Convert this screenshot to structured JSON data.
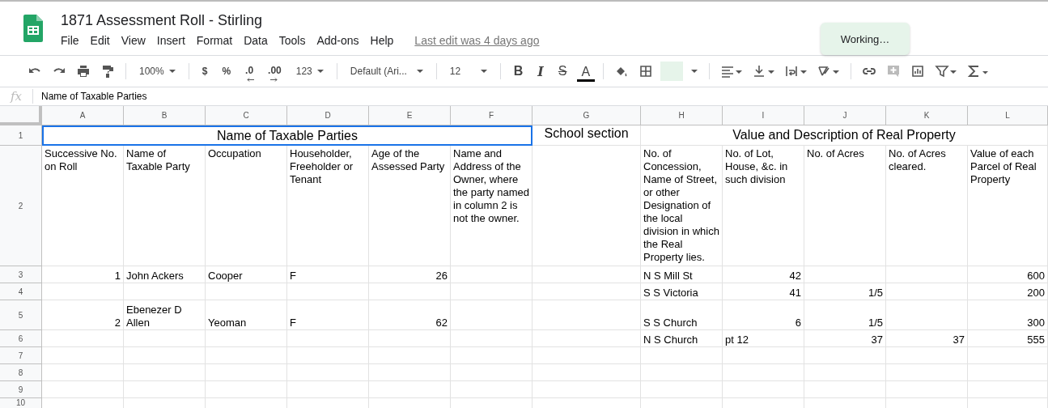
{
  "document": {
    "title": "1871 Assessment Roll - Stirling",
    "last_edit": "Last edit was 4 days ago"
  },
  "menu": [
    "File",
    "Edit",
    "View",
    "Insert",
    "Format",
    "Data",
    "Tools",
    "Add-ons",
    "Help"
  ],
  "toast": "Working…",
  "toolbar": {
    "zoom": "100%",
    "currency": "$",
    "percent": "%",
    "decrease_decimal": ".0",
    "increase_decimal": ".00",
    "more_formats": "123",
    "font": "Default (Ari...",
    "font_size": "12",
    "bold": "B",
    "italic": "I",
    "strikethrough": "S",
    "text_color": "A"
  },
  "formula_bar": {
    "label": "fx",
    "value": "Name of Taxable Parties"
  },
  "columns": [
    "A",
    "B",
    "C",
    "D",
    "E",
    "F",
    "G",
    "H",
    "I",
    "J",
    "K",
    "L"
  ],
  "rows": [
    {
      "number": "1",
      "kind": "title",
      "cells": [
        {
          "kind": "title",
          "text": "Name of Taxable Parties",
          "selected": true
        },
        {
          "kind": "merged"
        },
        {
          "kind": "merged"
        },
        {
          "kind": "merged"
        },
        {
          "kind": "merged"
        },
        {
          "kind": "merged"
        },
        {
          "kind": "text",
          "text": "School section",
          "selected": false
        },
        {
          "kind": "title",
          "text": "Value and Description of Real Property",
          "selected": false
        },
        {
          "kind": "merged"
        },
        {
          "kind": "merged"
        },
        {
          "kind": "merged"
        },
        {
          "kind": "merged"
        }
      ]
    },
    {
      "number": "2",
      "kind": "header",
      "cells": [
        {
          "kind": "text",
          "text": "Successive No. on Roll",
          "selected": false
        },
        {
          "kind": "text",
          "text": "Name of Taxable Party",
          "selected": false
        },
        {
          "kind": "text",
          "text": "Occupation",
          "selected": false
        },
        {
          "kind": "text",
          "text": "Householder, Freeholder or Tenant",
          "selected": false
        },
        {
          "kind": "text",
          "text": "Age of the Assessed Party",
          "selected": false
        },
        {
          "kind": "text",
          "text": "Name and Address of the Owner, where the party named in column 2 is not the owner.",
          "selected": false
        },
        {
          "kind": "empty"
        },
        {
          "kind": "text",
          "text": "No. of Concession, Name of Street, or other Designation of the local division in which the Real Property lies.",
          "selected": false
        },
        {
          "kind": "text",
          "text": "No. of Lot, House, &c. in such division",
          "selected": false
        },
        {
          "kind": "text",
          "text": "No. of Acres",
          "selected": false
        },
        {
          "kind": "text",
          "text": "No. of Acres cleared.",
          "selected": false
        },
        {
          "kind": "text",
          "text": "Value of each Parcel of Real Property",
          "selected": false
        }
      ]
    },
    {
      "number": "3",
      "kind": "data",
      "cells": [
        {
          "kind": "number",
          "text": "1",
          "selected": false
        },
        {
          "kind": "text",
          "text": "John Ackers",
          "selected": false
        },
        {
          "kind": "text",
          "text": "Cooper",
          "selected": false
        },
        {
          "kind": "text",
          "text": "F",
          "selected": false
        },
        {
          "kind": "number",
          "text": "26",
          "selected": false
        },
        {
          "kind": "empty"
        },
        {
          "kind": "empty"
        },
        {
          "kind": "text",
          "text": "N S Mill St",
          "selected": false
        },
        {
          "kind": "number",
          "text": "42",
          "selected": false
        },
        {
          "kind": "empty"
        },
        {
          "kind": "empty"
        },
        {
          "kind": "number",
          "text": "600",
          "selected": false
        }
      ]
    },
    {
      "number": "4",
      "kind": "data",
      "cells": [
        {
          "kind": "empty"
        },
        {
          "kind": "empty"
        },
        {
          "kind": "empty"
        },
        {
          "kind": "empty"
        },
        {
          "kind": "empty"
        },
        {
          "kind": "empty"
        },
        {
          "kind": "empty"
        },
        {
          "kind": "text",
          "text": "S S Victoria",
          "selected": false
        },
        {
          "kind": "number",
          "text": "41",
          "selected": false
        },
        {
          "kind": "number",
          "text": "1/5",
          "selected": false
        },
        {
          "kind": "empty"
        },
        {
          "kind": "number",
          "text": "200",
          "selected": false
        }
      ]
    },
    {
      "number": "5",
      "kind": "tall",
      "cells": [
        {
          "kind": "number",
          "text": "2",
          "selected": false
        },
        {
          "kind": "text",
          "text": "Ebenezer D Allen",
          "selected": false
        },
        {
          "kind": "text",
          "text": "Yeoman",
          "selected": false
        },
        {
          "kind": "text",
          "text": "F",
          "selected": false
        },
        {
          "kind": "number",
          "text": "62",
          "selected": false
        },
        {
          "kind": "empty"
        },
        {
          "kind": "empty"
        },
        {
          "kind": "text",
          "text": "S S Church",
          "selected": false
        },
        {
          "kind": "number",
          "text": "6",
          "selected": false
        },
        {
          "kind": "number",
          "text": "1/5",
          "selected": false
        },
        {
          "kind": "empty"
        },
        {
          "kind": "number",
          "text": "300",
          "selected": false
        }
      ]
    },
    {
      "number": "6",
      "kind": "data",
      "cells": [
        {
          "kind": "empty"
        },
        {
          "kind": "empty"
        },
        {
          "kind": "empty"
        },
        {
          "kind": "empty"
        },
        {
          "kind": "empty"
        },
        {
          "kind": "empty"
        },
        {
          "kind": "empty"
        },
        {
          "kind": "text",
          "text": "N S Church",
          "selected": false
        },
        {
          "kind": "text",
          "text": "pt 12",
          "selected": false
        },
        {
          "kind": "number",
          "text": "37",
          "selected": false
        },
        {
          "kind": "number",
          "text": "37",
          "selected": false
        },
        {
          "kind": "number",
          "text": "555",
          "selected": false
        }
      ]
    },
    {
      "number": "7",
      "kind": "data"
    },
    {
      "number": "8",
      "kind": "data"
    },
    {
      "number": "9",
      "kind": "data"
    },
    {
      "number": "10",
      "kind": "data"
    }
  ]
}
